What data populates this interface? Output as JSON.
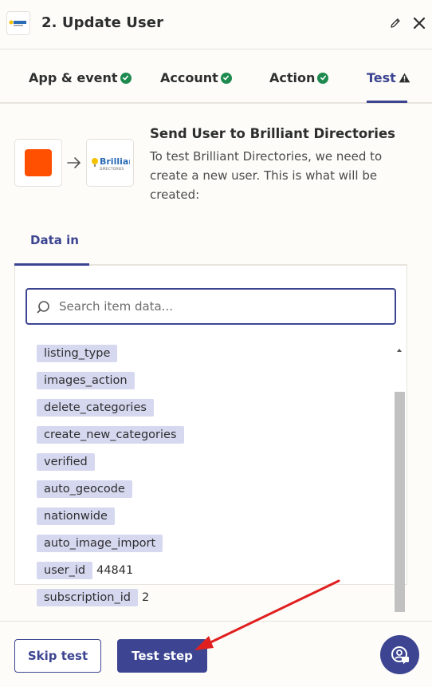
{
  "header": {
    "title": "2. Update User",
    "app_logo_alt": "Brilliant Directories"
  },
  "tabs": [
    {
      "label": "App & event",
      "status": "complete"
    },
    {
      "label": "Account",
      "status": "complete"
    },
    {
      "label": "Action",
      "status": "complete"
    },
    {
      "label": "Test",
      "status": "warning",
      "active": true
    }
  ],
  "step": {
    "title": "Send User to Brilliant Directories",
    "description": "To test Brilliant Directories, we need to create a new user. This is what will be created:",
    "trigger_icon_color": "#ff4f00",
    "brand_logo_text": "Brilliant",
    "brand_logo_subtext": "DIRECTORIES"
  },
  "data_in": {
    "tab_label": "Data in",
    "search_placeholder": "Search item data...",
    "items": [
      {
        "key": "listing_type",
        "value": ""
      },
      {
        "key": "images_action",
        "value": ""
      },
      {
        "key": "delete_categories",
        "value": ""
      },
      {
        "key": "create_new_categories",
        "value": ""
      },
      {
        "key": "verified",
        "value": ""
      },
      {
        "key": "auto_geocode",
        "value": ""
      },
      {
        "key": "nationwide",
        "value": ""
      },
      {
        "key": "auto_image_import",
        "value": ""
      },
      {
        "key": "user_id",
        "value": "44841"
      },
      {
        "key": "subscription_id",
        "value": "2"
      }
    ]
  },
  "footer": {
    "skip_label": "Skip test",
    "test_label": "Test step"
  },
  "colors": {
    "accent": "#3d4592",
    "success": "#1e8a4f",
    "annotation": "#e02020",
    "pill_bg": "#d6d8f0"
  },
  "icons": {
    "edit": "pencil-icon",
    "close": "close-icon",
    "check": "check-circle-icon",
    "warning": "warning-triangle-icon",
    "arrow": "arrow-right-icon",
    "search": "search-icon",
    "help": "help-chat-icon"
  }
}
